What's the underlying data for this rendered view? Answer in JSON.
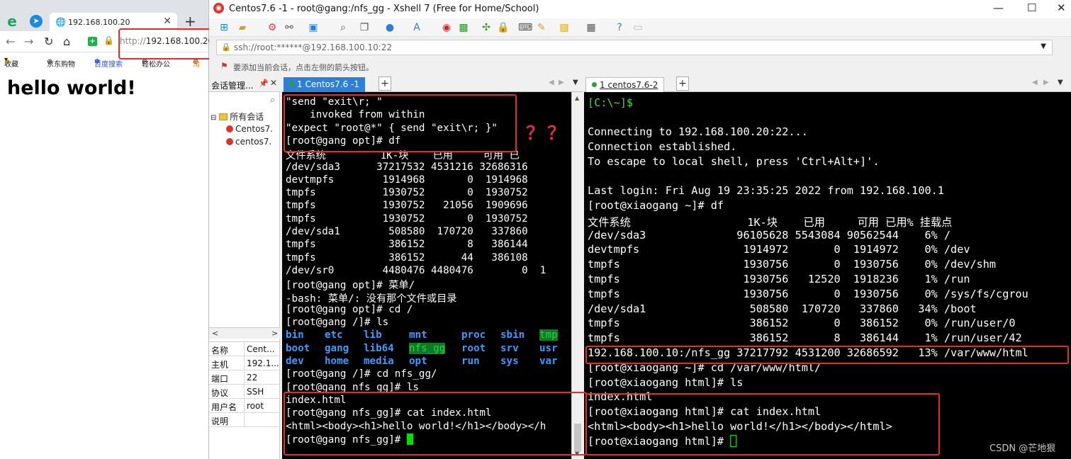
{
  "browser": {
    "tab_title": "192.168.100.20",
    "tab_close": "✕",
    "new_tab": "+",
    "url_protocol": "http://",
    "url_host": "192.168.100.20/",
    "bookmarks": [
      {
        "label": "收藏",
        "icon": "star-icon"
      },
      {
        "label": "京东购物",
        "icon": "globe-icon"
      },
      {
        "label": "百度搜索",
        "icon": "paw-icon"
      },
      {
        "label": "轻松办公",
        "icon": "globe-icon"
      },
      {
        "label": "淘",
        "icon": "globe-icon"
      }
    ],
    "page_heading": "hello world!"
  },
  "xshell": {
    "window_title": "Centos7.6 -1 - root@gang:/nfs_gg - Xshell 7 (Free for Home/School)",
    "address": "ssh://root:******@192.168.100.10:22",
    "tip": "要添加当前会话，点击左侧的箭头按钮。",
    "session_manager": {
      "title": "会话管理...",
      "tree_root": "所有会话",
      "sessions": [
        "Centos7.",
        "centos7."
      ],
      "properties": [
        {
          "key": "名称",
          "value": "Cent..."
        },
        {
          "key": "主机",
          "value": "192.1..."
        },
        {
          "key": "端口",
          "value": "22"
        },
        {
          "key": "协议",
          "value": "SSH"
        },
        {
          "key": "用户名",
          "value": "root"
        },
        {
          "key": "说明",
          "value": ""
        }
      ]
    },
    "tabs_left": [
      {
        "label": "1 Centos7.6 -1",
        "active": true
      }
    ],
    "tabs_right": [
      {
        "label": "1 centos7.6-2",
        "active": false
      }
    ],
    "add_tab": "+",
    "annotation_marks": "？？"
  },
  "terminal1": {
    "lines": [
      "\"send \"exit\\r; \"",
      "    invoked from within",
      "\"expect \"root@*\" { send \"exit\\r; }\"",
      "[root@gang opt]# df",
      "文件系统         1K-块    已用     可用 已",
      "/dev/sda3      37217532 4531216 32686316",
      "devtmpfs        1914968       0  1914968",
      "tmpfs           1930752       0  1930752",
      "tmpfs           1930752   21056  1909696",
      "tmpfs           1930752       0  1930752",
      "/dev/sda1        508580  170720   337860",
      "tmpfs            386152       8   386144",
      "tmpfs            386152      44   386108",
      "/dev/sr0        4480476 4480476        0  1",
      "[root@gang opt]# 菜单/",
      "-bash: 菜单/: 没有那个文件或目录",
      "[root@gang opt]# cd /",
      "[root@gang /]# ls"
    ],
    "ls_rows": [
      [
        "bin",
        "etc",
        "lib",
        "mnt",
        "proc",
        "sbin",
        "tmp"
      ],
      [
        "boot",
        "gang",
        "lib64",
        "nfs_gg",
        "root",
        "srv",
        "usr"
      ],
      [
        "dev",
        "home",
        "media",
        "opt",
        "run",
        "sys",
        "var"
      ]
    ],
    "lines_after": [
      "[root@gang /]# cd nfs_gg/",
      "[root@gang nfs_gg]# ls",
      "index.html",
      "[root@gang nfs_gg]# cat index.html",
      "<html><body><h1>hello world!</h1></body></h",
      "[root@gang nfs_gg]# "
    ]
  },
  "terminal2": {
    "local_prompt": "[C:\\~]$",
    "lines": [
      "Connecting to 192.168.100.20:22...",
      "Connection established.",
      "To escape to local shell, press 'Ctrl+Alt+]'.",
      "",
      "Last login: Fri Aug 19 23:35:25 2022 from 192.168.100.1",
      "[root@xiaogang ~]# df",
      "文件系统                  1K-块    已用     可用 已用% 挂载点",
      "/dev/sda3              96105628 5543084 90562544    6% /",
      "devtmpfs                1914972       0  1914972    0% /dev",
      "tmpfs                   1930756       0  1930756    0% /dev/shm",
      "tmpfs                   1930756   12520  1918236    1% /run",
      "tmpfs                   1930756       0  1930756    0% /sys/fs/cgrou",
      "/dev/sda1                508580  170720   337860   34% /boot",
      "tmpfs                    386152       0   386152    0% /run/user/0",
      "tmpfs                    386152       8   386144    1% /run/user/42",
      "192.168.100.10:/nfs_gg 37217792 4531200 32686592   13% /var/www/html",
      "[root@xiaogang ~]# cd /var/www/html/",
      "[root@xiaogang html]# ls",
      "index.html",
      "[root@xiaogang html]# cat index.html",
      "<html><body><h1>hello world!</h1></body></html>",
      "[root@xiaogang html]# "
    ]
  },
  "watermark": "CSDN @芒地狠",
  "colors": {
    "highlight_red": "#e52b2b",
    "terminal_bg": "#000000",
    "terminal_green": "#2fd22f",
    "dir_blue": "#3b9bff"
  }
}
